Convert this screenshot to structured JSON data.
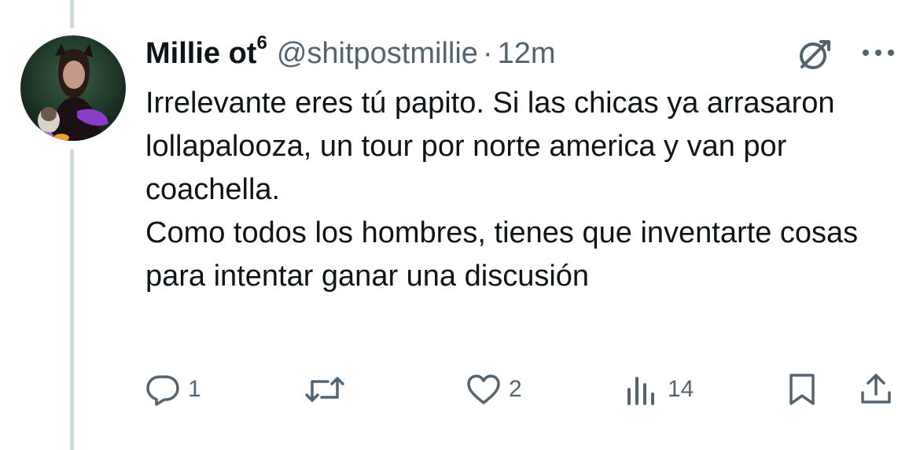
{
  "tweet": {
    "display_name": "Millie ot",
    "name_superscript": "6",
    "handle": "@shitpostmillie",
    "separator": "·",
    "time": "12m",
    "text_lines": [
      "Irrelevante eres tú papito. Si las chicas ya arrasaron lollapalooza, un tour por norte america y van por coachella.",
      "Como todos los hombres, tienes que inventarte cosas para intentar ganar una discusión"
    ]
  },
  "actions": {
    "replies": "1",
    "reposts": "",
    "likes": "2",
    "views": "14"
  },
  "icons": {
    "reply": "reply-icon",
    "repost": "repost-icon",
    "like": "like-icon",
    "views": "views-icon",
    "bookmark": "bookmark-icon",
    "share": "share-icon",
    "grok": "grok-icon",
    "more": "more-icon"
  },
  "colors": {
    "text": "#0f1419",
    "secondary": "#536471",
    "thread_line": "#cfd9de"
  }
}
